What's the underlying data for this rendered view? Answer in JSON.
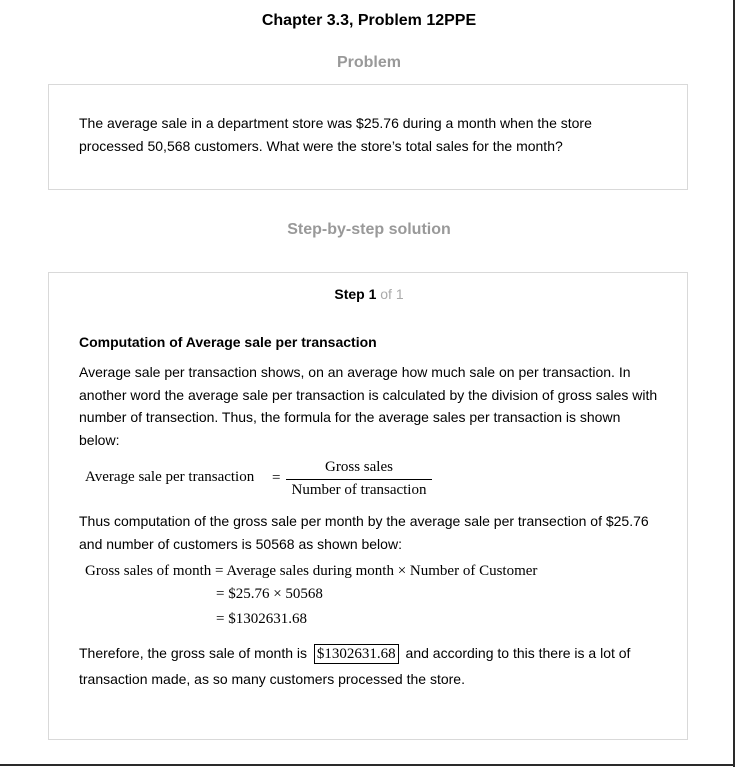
{
  "chapter_title": "Chapter 3.3, Problem 12PPE",
  "problem": {
    "heading": "Problem",
    "text": "The average sale in a department store was $25.76 during a month when the store processed 50,568 customers. What were the store’s total sales for the month?"
  },
  "solution": {
    "heading": "Step-by-step solution",
    "step_label": "Step 1",
    "step_of": " of 1",
    "sub_heading": "Computation of Average sale per transaction",
    "intro": "Average sale per transaction shows, on an average how much sale on per transaction. In another word the average sale per transaction is calculated by the division of gross sales with number of transection. Thus, the formula for the average sales per transaction is shown below:",
    "formula": {
      "lhs": "Average sale per transaction",
      "eq": "=",
      "numerator": "Gross sales",
      "denominator": "Number of transaction"
    },
    "middle": "Thus computation of the gross sale per month by the average sale per transection of $25.76 and number of customers is 50568 as shown below:",
    "calc": {
      "line1": "Gross sales of month = Average sales during month × Number of Customer",
      "line2": "= $25.76 × 50568",
      "line3": "= $1302631.68"
    },
    "conclusion_before": "Therefore, the gross sale of month is",
    "answer": "$1302631.68",
    "conclusion_after": "and according to this there is a lot of transaction made, as so many customers processed the store."
  }
}
